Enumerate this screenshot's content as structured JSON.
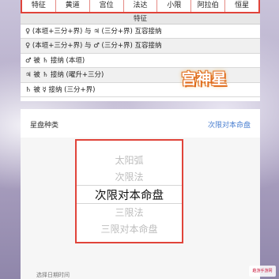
{
  "tabs": [
    "特征",
    "黄道",
    "宫位",
    "法达",
    "小限",
    "阿拉伯",
    "恒星"
  ],
  "table_header": "特征",
  "rows": [
    "♀ (本垣+三分+界) 与 ♃ (三分+界) 互容接纳",
    "♀ (本垣+三分+界) 与 ♂ (三分+界) 互容接纳",
    "♂ 被 ♄ 接纳 (本垣)",
    "♃ 被 ♄ 接纳 (曜升+三分)",
    "♄ 被 ☿ 接纳 (三分+界)"
  ],
  "brand_text": "宫神星",
  "picker": {
    "label": "星盘种类",
    "value": "次限对本命盘",
    "options": [
      "太阳弧",
      "次限法",
      "次限对本命盘",
      "三限法",
      "三限对本命盘"
    ],
    "selected_index": 2
  },
  "bottom_label": "选择日期时间",
  "watermark": "趣游手游网"
}
